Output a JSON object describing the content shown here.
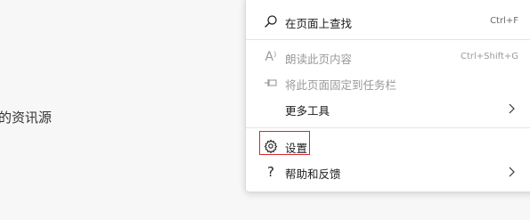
{
  "background": {
    "partial_text": "的资讯源"
  },
  "menu": {
    "items": [
      {
        "label": "在页面上查找",
        "shortcut": "Ctrl+F",
        "icon": "search-icon",
        "disabled": false
      },
      {
        "label": "朗读此页内容",
        "shortcut": "Ctrl+Shift+G",
        "icon": "read-aloud-icon",
        "disabled": true
      },
      {
        "label": "将此页面固定到任务栏",
        "shortcut": "",
        "icon": "pin-icon",
        "disabled": true
      },
      {
        "label": "更多工具",
        "shortcut": "",
        "icon": "",
        "disabled": false,
        "submenu": true
      },
      {
        "label": "设置",
        "shortcut": "",
        "icon": "gear-icon",
        "disabled": false,
        "highlighted": true
      },
      {
        "label": "帮助和反馈",
        "shortcut": "",
        "icon": "help-icon",
        "disabled": false,
        "submenu": true
      }
    ],
    "icon_glyphs": {
      "read_aloud": "A⁾",
      "help": "?"
    }
  },
  "colors": {
    "highlight_border": "#d9262e",
    "disabled_text": "#9a9a9a",
    "menu_background": "#ffffff",
    "page_background": "#f7f7f7"
  }
}
